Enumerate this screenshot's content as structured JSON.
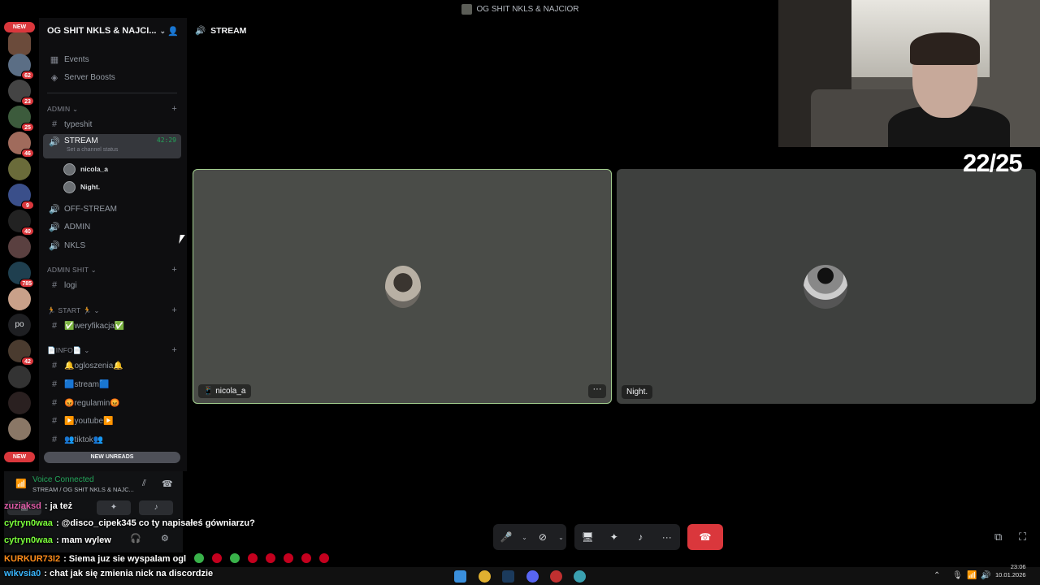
{
  "window": {
    "title": "OG SHIT NKLS & NAJCIOR"
  },
  "rail": {
    "new_top": "NEW",
    "new_bottom": "NEW",
    "badges": [
      "62",
      "23",
      "25",
      "46",
      "9",
      "40",
      "785",
      "42"
    ],
    "text_server": "po"
  },
  "sidebar": {
    "guild_name": "OG SHIT NKLS & NAJCI...",
    "top_items": [
      {
        "label": "Events",
        "icon": "calendar-icon"
      },
      {
        "label": "Server Boosts",
        "icon": "boost-icon"
      }
    ],
    "categories": {
      "admin": "ADMIN",
      "admin_shit": "ADMIN SHIT",
      "start": "START",
      "info": "INFO"
    },
    "channels": {
      "typeshit": "typeshit",
      "stream": "STREAM",
      "stream_time": "42:29",
      "stream_status": "Set a channel status",
      "voice_users": [
        "nicola_a",
        "Night."
      ],
      "off_stream": "OFF-STREAM",
      "admin": "ADMIN",
      "nkls": "NKLS",
      "logi": "logi",
      "weryfikacja": "✅weryfikacja✅",
      "ogloszenia": "🔔ogloszenia🔔",
      "stream_text": "🟦stream🟦",
      "regulamin": "😡regulamin😡",
      "youtube": "▶️youtube▶️",
      "tiktok": "👥tiktok👥"
    },
    "new_unreads": "NEW UNREADS"
  },
  "voice_panel": {
    "status": "Voice Connected",
    "location": "STREAM / OG SHIT NKLS & NAJC..."
  },
  "main": {
    "channel_name": "STREAM",
    "tiles": [
      {
        "name": "nicola_a",
        "speaking": true
      },
      {
        "name": "Night.",
        "speaking": false
      }
    ]
  },
  "overlay": {
    "counter": "22/25",
    "chat": [
      {
        "user": "zuziaksd",
        "text": ": ja też",
        "color": "#e05ca8"
      },
      {
        "user": "cytryn0waa",
        "text": ": @disco_cipek345 co ty napisałeś gówniarzu?",
        "color": "#7bff3a"
      },
      {
        "user": "cytryn0waa",
        "text": ": mam wylew",
        "color": "#7bff3a"
      },
      {
        "user": "KURKUR73I2",
        "text": ": Siema juz sie wyspalam ogl",
        "color": "#ff8c1a"
      },
      {
        "user": "wikvsia0",
        "text": ": chat jak się zmienia nick na discordzie",
        "color": "#3ab7ff"
      }
    ]
  },
  "taskbar": {
    "time": "23:06",
    "date": "10.01.2026"
  },
  "colors": {
    "accent_green": "#23a55a",
    "danger_red": "#da373c",
    "speaking_border": "#a3cf8f"
  }
}
